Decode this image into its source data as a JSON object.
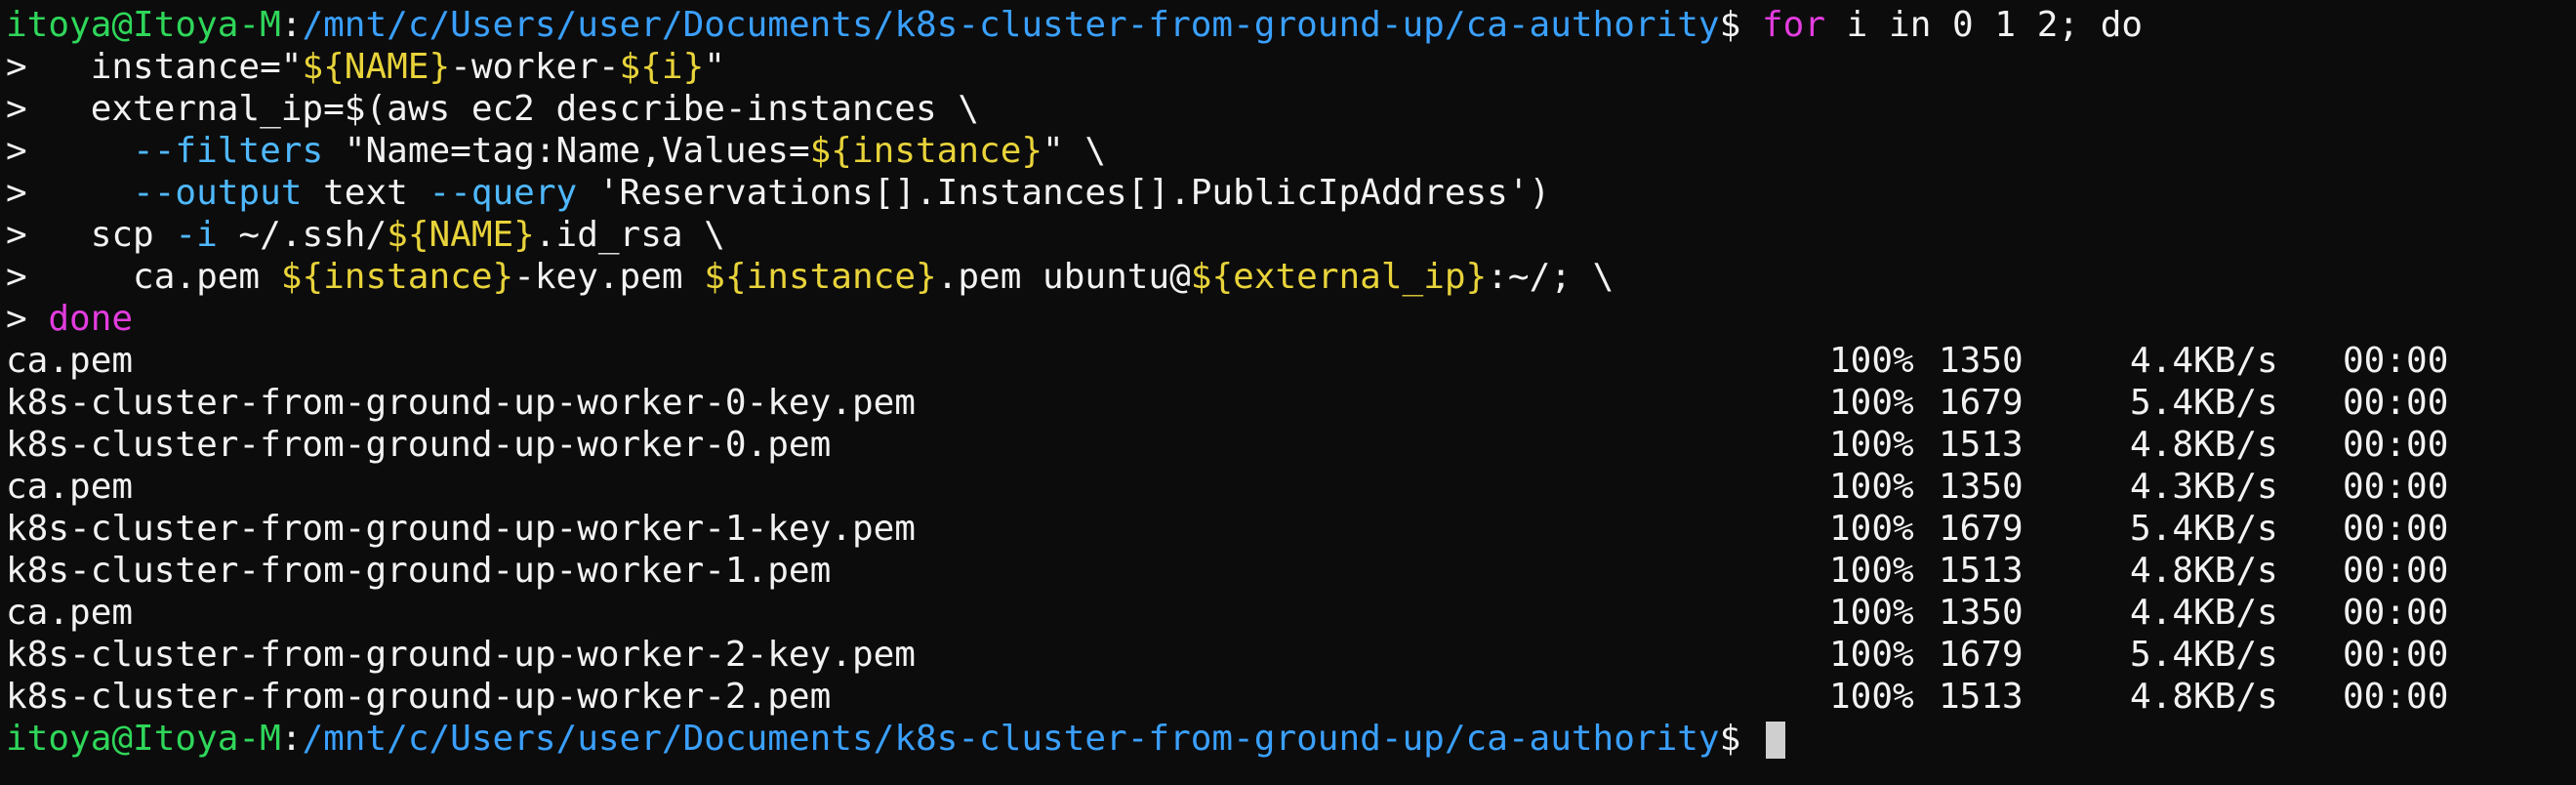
{
  "prompt": {
    "user": "itoya@Itoya-M",
    "sep": ":",
    "path": "/mnt/c/Users/user/Documents/k8s-cluster-from-ground-up/ca-authority",
    "symbol": "$ "
  },
  "command": {
    "line1": {
      "kw_for": "for",
      "rest": " i in 0 1 2; do"
    },
    "line2": {
      "cont": ">   instance=\"",
      "v1": "${NAME}",
      "mid": "-worker-",
      "v2": "${i}",
      "end": "\""
    },
    "line3": {
      "text": ">   external_ip=$(aws ec2 describe-instances \\"
    },
    "line4": {
      "indent": ">     ",
      "flag": "--filters",
      "mid": " \"Name=tag:Name,Values=",
      "var": "${instance}",
      "end": "\" \\"
    },
    "line5": {
      "indent": ">     ",
      "flag1": "--output",
      "mid": " text ",
      "flag2": "--query",
      "end": " 'Reservations[].Instances[].PublicIpAddress')"
    },
    "line6": {
      "start": ">   scp ",
      "flag": "-i",
      "mid": " ~/.ssh/",
      "var": "${NAME}",
      "end": ".id_rsa \\"
    },
    "line7": {
      "start": ">     ca.pem ",
      "v1": "${instance}",
      "m1": "-key.pem ",
      "v2": "${instance}",
      "m2": ".pem ubuntu@",
      "v3": "${external_ip}",
      "end": ":~/; \\"
    },
    "line8": {
      "prefix": "> ",
      "kw_done": "done"
    }
  },
  "transfers": [
    {
      "file": "ca.pem",
      "percent": "100%",
      "bytes": "1350",
      "rate": "4.4KB/s",
      "time": "00:00"
    },
    {
      "file": "k8s-cluster-from-ground-up-worker-0-key.pem",
      "percent": "100%",
      "bytes": "1679",
      "rate": "5.4KB/s",
      "time": "00:00"
    },
    {
      "file": "k8s-cluster-from-ground-up-worker-0.pem",
      "percent": "100%",
      "bytes": "1513",
      "rate": "4.8KB/s",
      "time": "00:00"
    },
    {
      "file": "ca.pem",
      "percent": "100%",
      "bytes": "1350",
      "rate": "4.3KB/s",
      "time": "00:00"
    },
    {
      "file": "k8s-cluster-from-ground-up-worker-1-key.pem",
      "percent": "100%",
      "bytes": "1679",
      "rate": "5.4KB/s",
      "time": "00:00"
    },
    {
      "file": "k8s-cluster-from-ground-up-worker-1.pem",
      "percent": "100%",
      "bytes": "1513",
      "rate": "4.8KB/s",
      "time": "00:00"
    },
    {
      "file": "ca.pem",
      "percent": "100%",
      "bytes": "1350",
      "rate": "4.4KB/s",
      "time": "00:00"
    },
    {
      "file": "k8s-cluster-from-ground-up-worker-2-key.pem",
      "percent": "100%",
      "bytes": "1679",
      "rate": "5.4KB/s",
      "time": "00:00"
    },
    {
      "file": "k8s-cluster-from-ground-up-worker-2.pem",
      "percent": "100%",
      "bytes": "1513",
      "rate": "4.8KB/s",
      "time": "00:00"
    }
  ],
  "colors": {
    "background": "#0c0c0c",
    "foreground": "#f2f2f2",
    "user": "#2fd65a",
    "path": "#3aa0ff",
    "keyword": "#e33cde",
    "variable": "#e8d33a",
    "flag": "#4fb8ff"
  }
}
